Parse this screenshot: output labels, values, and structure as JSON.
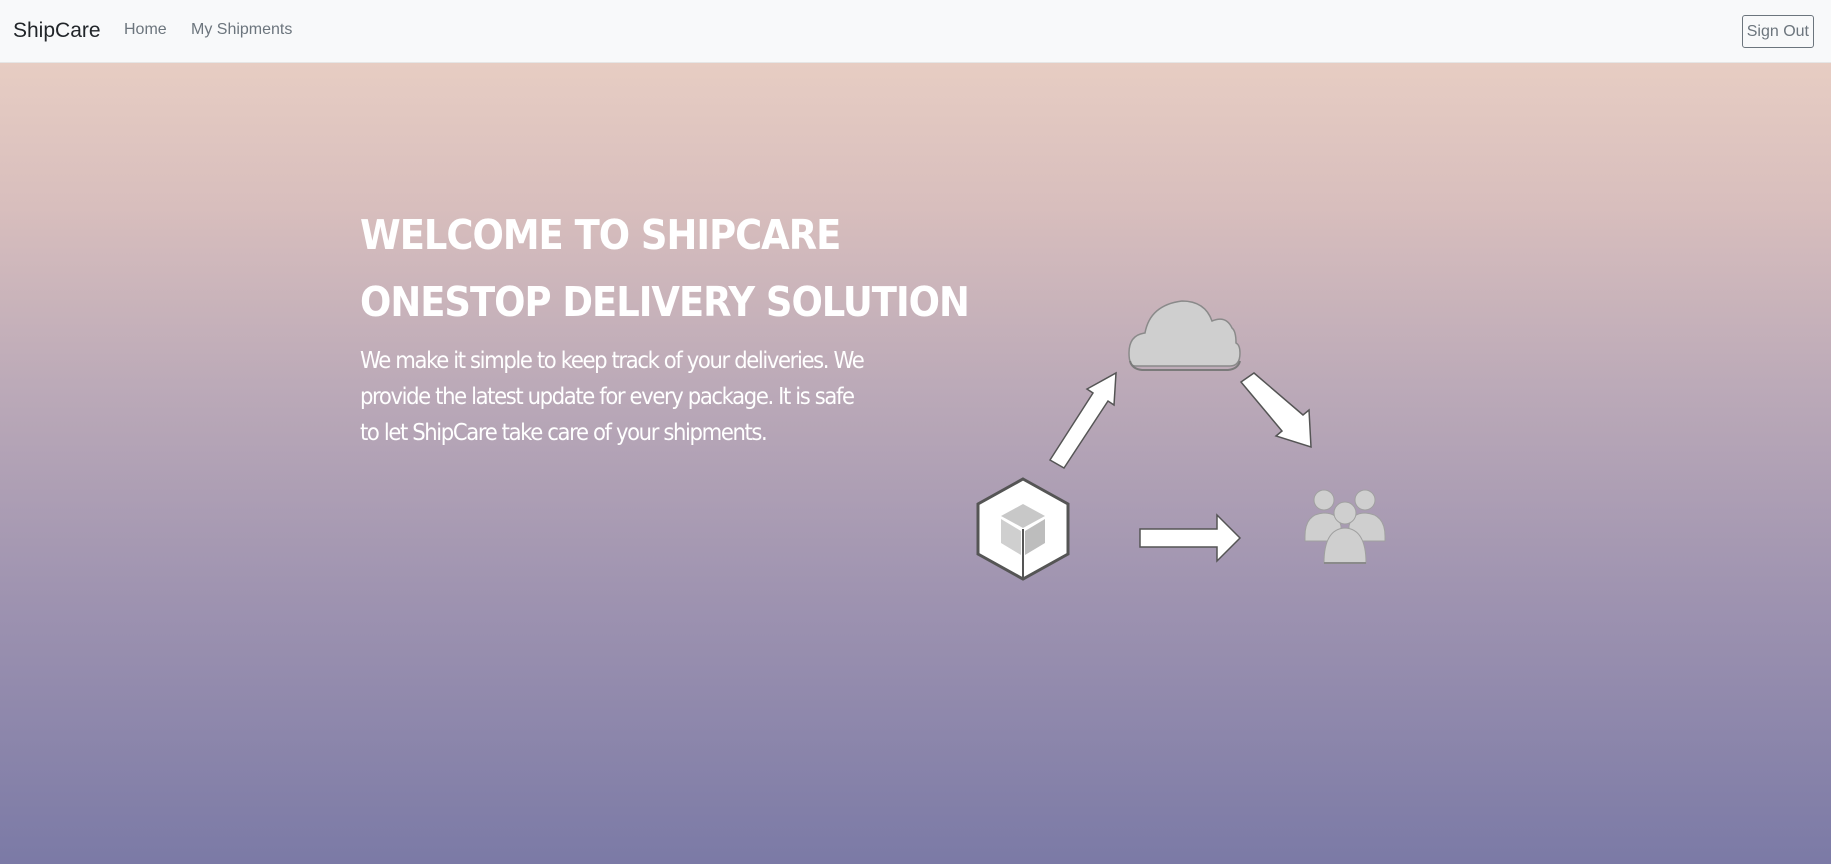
{
  "navbar": {
    "brand": "ShipCare",
    "links": [
      "Home",
      "My Shipments"
    ],
    "signout_label": "Sign Out"
  },
  "hero": {
    "headline_1": "WELCOME TO SHIPCARE",
    "headline_2": "ONESTOP DELIVERY SOLUTION",
    "description": "We make it simple to keep track of your deliveries. We provide the latest update for every package. It is safe to let ShipCare take care of your shipments."
  },
  "illustration": {
    "icons": [
      "box-icon",
      "cloud-icon",
      "users-icon",
      "arrow-icon"
    ]
  },
  "colors": {
    "navbar_bg": "#f8f9fa",
    "gradient_top": "#e7cdc3",
    "gradient_bottom": "#7b7aa6",
    "text_white": "#ffffff"
  }
}
